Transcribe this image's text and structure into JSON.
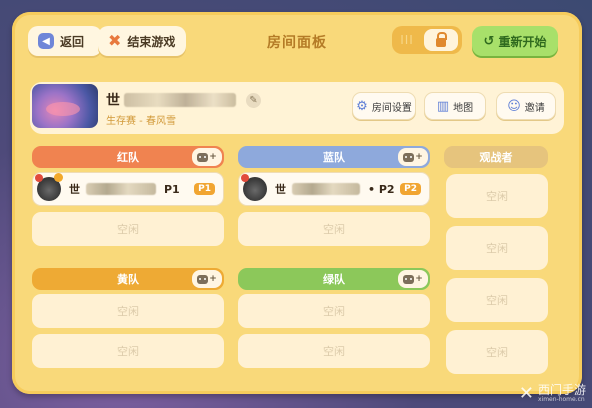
{
  "header": {
    "back_label": "返回",
    "end_label": "结束游戏",
    "title": "房间面板",
    "lock_toggle_bars": "III",
    "restart_label": "重新开始"
  },
  "room": {
    "name_prefix": "世",
    "mode": "生存赛 - 春风雪",
    "settings_label": "房间设置",
    "map_label": "地图",
    "invite_label": "邀请"
  },
  "teams": [
    {
      "name": "红队",
      "color": "#f08350",
      "slots": [
        {
          "player": "世",
          "label": "P1",
          "tag": "P1"
        },
        {
          "empty": "空闲"
        }
      ]
    },
    {
      "name": "蓝队",
      "color": "#8ea9dc",
      "slots": [
        {
          "player": "世",
          "label": "• P2",
          "tag": "P2"
        },
        {
          "empty": "空闲"
        }
      ]
    },
    {
      "name": "黄队",
      "color": "#eeaa34",
      "slots": [
        {
          "empty": "空闲"
        },
        {
          "empty": "空闲"
        }
      ]
    },
    {
      "name": "绿队",
      "color": "#8cc85a",
      "slots": [
        {
          "empty": "空闲"
        },
        {
          "empty": "空闲"
        }
      ]
    }
  ],
  "bot_chip_label": "+",
  "spectators": {
    "title": "观战者",
    "slots": [
      "空闲",
      "空闲",
      "空闲",
      "空闲"
    ]
  },
  "watermark": {
    "text": "西门手游",
    "sub": "ximen-home.cn"
  }
}
